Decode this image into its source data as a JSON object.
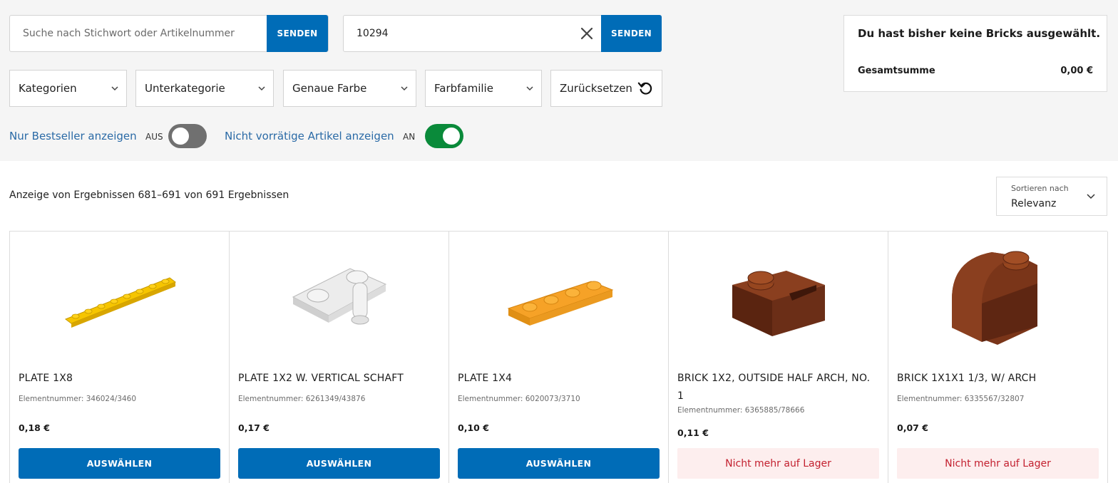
{
  "search": {
    "keyword_placeholder": "Suche nach Stichwort oder Artikelnummer",
    "keyword_value": "",
    "send_label_1": "SENDEN",
    "set_value": "10294",
    "send_label_2": "SENDEN"
  },
  "filters": {
    "kategorien": "Kategorien",
    "unterkategorie": "Unterkategorie",
    "genaue_farbe": "Genaue Farbe",
    "farbfamilie": "Farbfamilie",
    "reset": "Zurücksetzen"
  },
  "toggles": {
    "bestseller_label": "Nur Bestseller anzeigen",
    "bestseller_state": "AUS",
    "bestseller_on": false,
    "out_of_stock_label": "Nicht vorrätige Artikel anzeigen",
    "out_of_stock_state": "AN",
    "out_of_stock_on": true
  },
  "summary": {
    "message": "Du hast bisher keine Bricks ausgewählt.",
    "total_label": "Gesamtsumme",
    "total_value": "0,00 €"
  },
  "results": {
    "text": "Anzeige von Ergebnissen 681–691 von 691 Ergebnissen"
  },
  "sort": {
    "label": "Sortieren nach",
    "value": "Relevanz"
  },
  "colors": {
    "primary_blue": "#006cb7",
    "toggle_on": "#0a8a3a",
    "toggle_off": "#707070",
    "out_of_stock_bg": "#fdeeee",
    "out_of_stock_text": "#c3202f",
    "link_blue": "#2a6aa6"
  },
  "products": [
    {
      "name": "PLATE 1X8",
      "element": "Elementnummer: 346024/3460",
      "price": "0,18 €",
      "action": "AUSWÄHLEN",
      "available": true,
      "color": "#f6c500",
      "icon": "plate-1x8-icon"
    },
    {
      "name": "PLATE 1X2 W. VERTICAL SCHAFT",
      "element": "Elementnummer: 6261349/43876",
      "price": "0,17 €",
      "action": "AUSWÄHLEN",
      "available": true,
      "color": "#e6e6e6",
      "icon": "plate-1x2-shaft-icon"
    },
    {
      "name": "PLATE 1X4",
      "element": "Elementnummer: 6020073/3710",
      "price": "0,10 €",
      "action": "AUSWÄHLEN",
      "available": true,
      "color": "#f6a227",
      "icon": "plate-1x4-icon"
    },
    {
      "name": "BRICK 1X2, OUTSIDE HALF ARCH, NO. 1",
      "element": "Elementnummer: 6365885/78666",
      "price": "0,11 €",
      "action": "Nicht mehr auf Lager",
      "available": false,
      "color": "#6b2e17",
      "icon": "brick-half-arch-icon"
    },
    {
      "name": "BRICK 1X1X1 1/3, W/ ARCH",
      "element": "Elementnummer: 6335567/32807",
      "price": "0,07 €",
      "action": "Nicht mehr auf Lager",
      "available": false,
      "color": "#6e2f18",
      "icon": "brick-arch-icon"
    }
  ]
}
